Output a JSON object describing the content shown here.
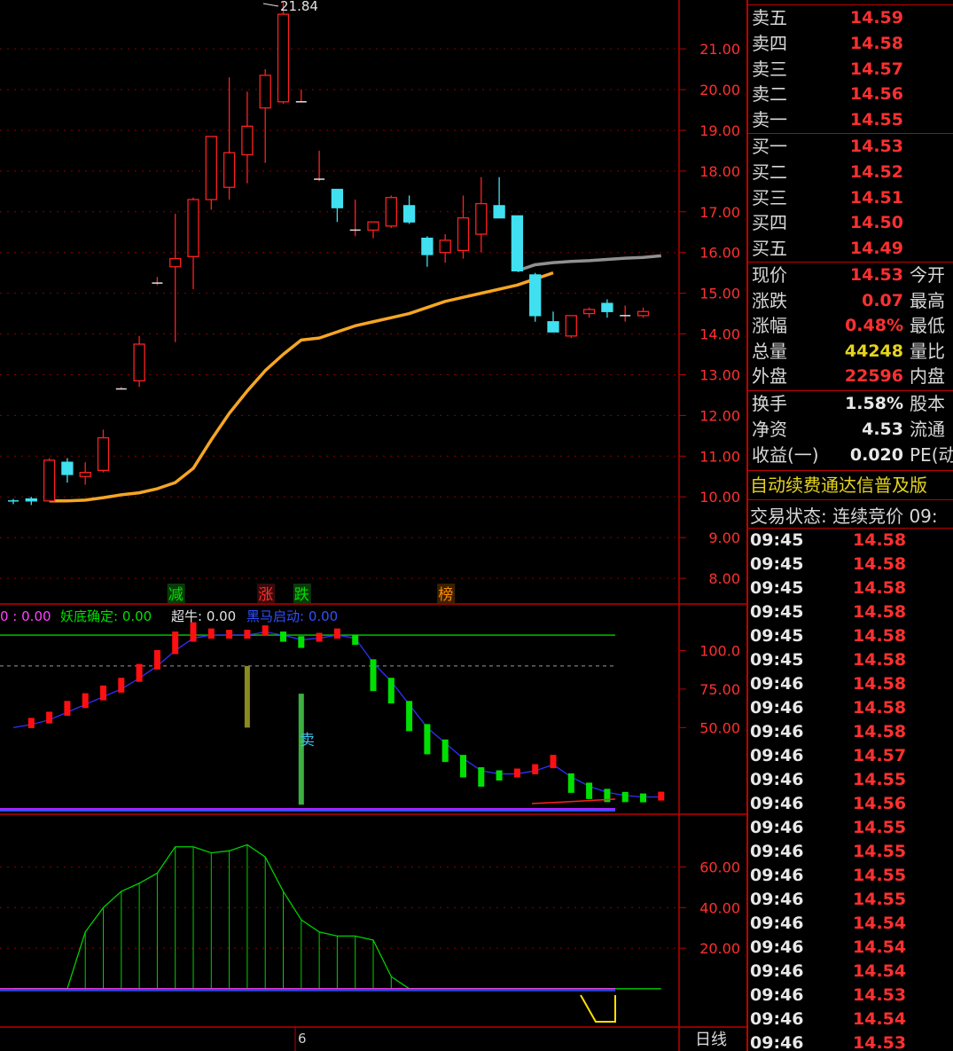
{
  "chart_data": {
    "type": "candlestick",
    "ylim": [
      7.5,
      22.2
    ],
    "y_ticks": [
      "21.00",
      "20.00",
      "19.00",
      "18.00",
      "17.00",
      "16.00",
      "15.00",
      "14.00",
      "13.00",
      "12.00",
      "11.00",
      "10.00",
      "9.00",
      "8.00"
    ],
    "y_tick_values": [
      21,
      20,
      19,
      18,
      17,
      16,
      15,
      14,
      13,
      12,
      11,
      10,
      9,
      8
    ],
    "max_label": "21.84",
    "candles": [
      {
        "o": 9.9,
        "h": 9.95,
        "l": 9.82,
        "c": 9.88
      },
      {
        "o": 9.95,
        "h": 10.0,
        "l": 9.8,
        "c": 9.9
      },
      {
        "o": 9.9,
        "h": 10.95,
        "l": 9.9,
        "c": 10.9
      },
      {
        "o": 10.85,
        "h": 10.95,
        "l": 10.35,
        "c": 10.55
      },
      {
        "o": 10.5,
        "h": 10.85,
        "l": 10.3,
        "c": 10.6
      },
      {
        "o": 10.65,
        "h": 11.65,
        "l": 10.6,
        "c": 11.45
      },
      {
        "o": 12.65,
        "h": 12.7,
        "l": 12.65,
        "c": 12.65
      },
      {
        "o": 12.85,
        "h": 13.95,
        "l": 12.7,
        "c": 13.75
      },
      {
        "o": 15.25,
        "h": 15.4,
        "l": 15.2,
        "c": 15.25
      },
      {
        "o": 15.65,
        "h": 16.95,
        "l": 13.8,
        "c": 15.85
      },
      {
        "o": 15.9,
        "h": 17.35,
        "l": 15.1,
        "c": 17.3
      },
      {
        "o": 17.3,
        "h": 18.8,
        "l": 17.05,
        "c": 18.85
      },
      {
        "o": 17.6,
        "h": 20.3,
        "l": 17.3,
        "c": 18.45
      },
      {
        "o": 18.4,
        "h": 19.95,
        "l": 17.7,
        "c": 19.1
      },
      {
        "o": 19.55,
        "h": 20.5,
        "l": 18.2,
        "c": 20.35
      },
      {
        "o": 19.7,
        "h": 22.15,
        "l": 19.65,
        "c": 21.85
      },
      {
        "o": 19.7,
        "h": 20.0,
        "l": 19.7,
        "c": 19.7
      },
      {
        "o": 17.8,
        "h": 18.5,
        "l": 17.75,
        "c": 17.8
      },
      {
        "o": 17.55,
        "h": 17.55,
        "l": 16.75,
        "c": 17.1
      },
      {
        "o": 16.55,
        "h": 17.3,
        "l": 16.4,
        "c": 16.55
      },
      {
        "o": 16.55,
        "h": 16.75,
        "l": 16.35,
        "c": 16.75
      },
      {
        "o": 16.65,
        "h": 17.4,
        "l": 16.6,
        "c": 17.35
      },
      {
        "o": 17.15,
        "h": 17.4,
        "l": 16.7,
        "c": 16.75
      },
      {
        "o": 16.35,
        "h": 16.4,
        "l": 15.65,
        "c": 15.95
      },
      {
        "o": 16.0,
        "h": 16.45,
        "l": 15.75,
        "c": 16.3
      },
      {
        "o": 16.05,
        "h": 17.4,
        "l": 15.85,
        "c": 16.85
      },
      {
        "o": 16.45,
        "h": 17.85,
        "l": 16.0,
        "c": 17.2
      },
      {
        "o": 17.15,
        "h": 17.85,
        "l": 16.9,
        "c": 16.85
      },
      {
        "o": 16.9,
        "h": 16.9,
        "l": 15.55,
        "c": 15.55
      },
      {
        "o": 15.45,
        "h": 15.5,
        "l": 14.3,
        "c": 14.45
      },
      {
        "o": 14.3,
        "h": 14.55,
        "l": 14.05,
        "c": 14.05
      },
      {
        "o": 13.95,
        "h": 14.45,
        "l": 13.9,
        "c": 14.45
      },
      {
        "o": 14.5,
        "h": 14.65,
        "l": 14.4,
        "c": 14.6
      },
      {
        "o": 14.75,
        "h": 14.85,
        "l": 14.4,
        "c": 14.55
      },
      {
        "o": 14.45,
        "h": 14.7,
        "l": 14.3,
        "c": 14.45
      },
      {
        "o": 14.45,
        "h": 14.65,
        "l": 14.4,
        "c": 14.55
      }
    ],
    "ma_line": [
      9.9,
      9.9,
      9.92,
      9.98,
      10.05,
      10.1,
      10.2,
      10.35,
      10.7,
      11.4,
      12.05,
      12.6,
      13.1,
      13.5,
      13.85,
      13.9,
      14.05,
      14.2,
      14.3,
      14.4,
      14.5,
      14.65,
      14.8,
      14.9,
      15.0,
      15.1,
      15.2,
      15.35,
      15.5
    ],
    "gray_line": [
      15.55,
      15.7,
      15.75,
      15.78,
      15.8,
      15.83,
      15.86,
      15.88,
      15.92
    ],
    "signals": [
      {
        "text": "减",
        "color": "#00e000",
        "bg": "#0a3a0a",
        "index": 9
      },
      {
        "text": "涨",
        "color": "#ff3030",
        "bg": "#3a0a0a",
        "index": 14
      },
      {
        "text": "跌",
        "color": "#00e000",
        "bg": "#0a3a0a",
        "index": 16
      },
      {
        "text": "榜",
        "color": "#ff8c00",
        "bg": "#3a2000",
        "index": 24
      }
    ],
    "ind1": {
      "legend": [
        {
          "text": "0 : 0.00",
          "color": "#ff40ff"
        },
        {
          "text": "妖底确定: 0.00",
          "color": "#00e000"
        },
        {
          "text": "超牛: 0.00",
          "color": "#e0e0e0"
        },
        {
          "text": "黑马启动: 0.00",
          "color": "#3050ff"
        }
      ],
      "y_ticks": [
        "100.0",
        "75.00",
        "50.00"
      ],
      "y_tick_values": [
        100,
        75,
        50
      ],
      "ylim": [
        -5,
        125
      ],
      "ref_line": 110,
      "dash_line": 90,
      "values": [
        50,
        52,
        55,
        60,
        65,
        70,
        75,
        82,
        90,
        100,
        108,
        110,
        110,
        110,
        112,
        110,
        107,
        108,
        110,
        108,
        92,
        80,
        65,
        50,
        40,
        30,
        22,
        20,
        20,
        22,
        26,
        18,
        12,
        8,
        6,
        5,
        5
      ],
      "sell_text": "卖",
      "bars": [
        {
          "index": 13,
          "from": 50,
          "to": 90,
          "color": "#8a8a20"
        },
        {
          "index": 16,
          "from": 0,
          "to": 72,
          "color": "#3cb040"
        }
      ]
    },
    "ind2": {
      "y_ticks": [
        "60.00",
        "40.00",
        "20.00"
      ],
      "y_tick_values": [
        60,
        40,
        20
      ],
      "ylim": [
        -18,
        83
      ],
      "values": [
        0,
        0,
        0,
        0,
        28,
        40,
        48,
        52,
        57,
        70,
        70,
        67,
        68,
        71,
        65,
        48,
        34,
        28,
        26,
        26,
        24,
        6,
        0,
        0,
        0,
        0,
        0,
        0,
        0,
        0,
        0,
        0,
        0,
        0,
        0,
        0,
        0
      ]
    },
    "x_label": "6",
    "period_label": "日线"
  },
  "quote": {
    "asks": [
      {
        "label": "卖五",
        "price": "14.59"
      },
      {
        "label": "卖四",
        "price": "14.58"
      },
      {
        "label": "卖三",
        "price": "14.57"
      },
      {
        "label": "卖二",
        "price": "14.56"
      },
      {
        "label": "卖一",
        "price": "14.55"
      }
    ],
    "bids": [
      {
        "label": "买一",
        "price": "14.53"
      },
      {
        "label": "买二",
        "price": "14.52"
      },
      {
        "label": "买三",
        "price": "14.51"
      },
      {
        "label": "买四",
        "price": "14.50"
      },
      {
        "label": "买五",
        "price": "14.49"
      }
    ],
    "stats1": [
      {
        "label": "现价",
        "value": "14.53",
        "color": "#ff3030",
        "label2": "今开"
      },
      {
        "label": "涨跌",
        "value": "0.07",
        "color": "#ff3030",
        "label2": "最高"
      },
      {
        "label": "涨幅",
        "value": "0.48%",
        "color": "#ff3030",
        "label2": "最低"
      },
      {
        "label": "总量",
        "value": "44248",
        "color": "#e6d41c",
        "label2": "量比"
      },
      {
        "label": "外盘",
        "value": "22596",
        "color": "#ff3030",
        "label2": "内盘"
      }
    ],
    "stats2": [
      {
        "label": "换手",
        "value": "1.58%",
        "color": "#e8e8e8",
        "label2": "股本"
      },
      {
        "label": "净资",
        "value": "4.53",
        "color": "#e8e8e8",
        "label2": "流通"
      },
      {
        "label": "收益(一)",
        "value": "0.020",
        "color": "#e8e8e8",
        "label2": "PE(动"
      }
    ],
    "notice": "自动续费通达信普及版",
    "status": "交易状态: 连续竞价 09:"
  },
  "ticks": [
    {
      "time": "09:45",
      "price": "14.58"
    },
    {
      "time": "09:45",
      "price": "14.58"
    },
    {
      "time": "09:45",
      "price": "14.58"
    },
    {
      "time": "09:45",
      "price": "14.58"
    },
    {
      "time": "09:45",
      "price": "14.58"
    },
    {
      "time": "09:45",
      "price": "14.58"
    },
    {
      "time": "09:46",
      "price": "14.58"
    },
    {
      "time": "09:46",
      "price": "14.58"
    },
    {
      "time": "09:46",
      "price": "14.58"
    },
    {
      "time": "09:46",
      "price": "14.57"
    },
    {
      "time": "09:46",
      "price": "14.55"
    },
    {
      "time": "09:46",
      "price": "14.56"
    },
    {
      "time": "09:46",
      "price": "14.55"
    },
    {
      "time": "09:46",
      "price": "14.55"
    },
    {
      "time": "09:46",
      "price": "14.55"
    },
    {
      "time": "09:46",
      "price": "14.55"
    },
    {
      "time": "09:46",
      "price": "14.54"
    },
    {
      "time": "09:46",
      "price": "14.54"
    },
    {
      "time": "09:46",
      "price": "14.54"
    },
    {
      "time": "09:46",
      "price": "14.53"
    },
    {
      "time": "09:46",
      "price": "14.54"
    },
    {
      "time": "09:46",
      "price": "14.53"
    }
  ]
}
